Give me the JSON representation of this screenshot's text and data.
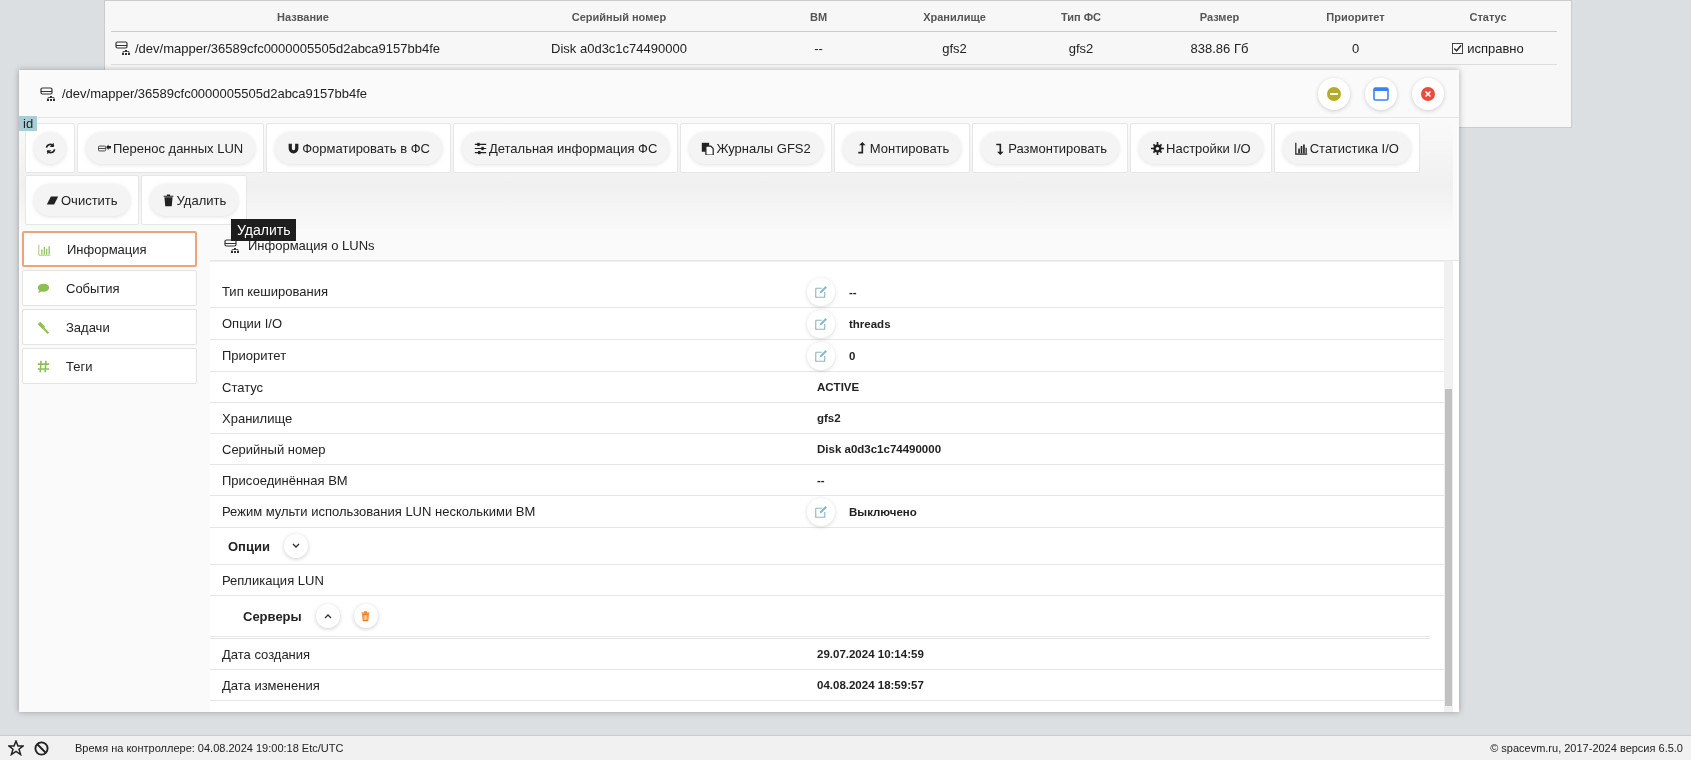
{
  "background_table": {
    "columns": [
      "Название",
      "Серийный номер",
      "ВМ",
      "Хранилище",
      "Тип ФС",
      "Размер",
      "Приоритет",
      "Статус"
    ],
    "rows": [
      {
        "cells": [
          "/dev/mapper/36589cfc0000005505d2abca9157bb4fe",
          "Disk a0d3c1c74490000",
          "--",
          "gfs2",
          "gfs2",
          "838.86 Гб",
          "0",
          "исправно"
        ]
      }
    ]
  },
  "window": {
    "title": "/dev/mapper/36589cfc0000005505d2abca9157bb4fe"
  },
  "badge": "id",
  "toolbar": {
    "rows": [
      [
        "",
        "Перенос данных LUN",
        "Форматировать в ФС",
        "Детальная информация ФС",
        "Журналы GFS2",
        "Монтировать",
        "Размонтировать",
        "Настройки I/O",
        "Статистика I/O"
      ],
      [
        "Очистить",
        "Удалить"
      ]
    ]
  },
  "tooltip": "Удалить",
  "sidebar": {
    "items": [
      {
        "label": "Информация",
        "selected": true
      },
      {
        "label": "События",
        "selected": false
      },
      {
        "label": "Задачи",
        "selected": false
      },
      {
        "label": "Теги",
        "selected": false
      }
    ]
  },
  "content": {
    "title": "Информация о LUNs",
    "rows": [
      {
        "kind": "field",
        "label": "Тип кеширования",
        "value": "--",
        "editable": true
      },
      {
        "kind": "field",
        "label": "Опции I/O",
        "value": "threads",
        "editable": true
      },
      {
        "kind": "field",
        "label": "Приоритет",
        "value": "0",
        "editable": true
      },
      {
        "kind": "field",
        "label": "Статус",
        "value": "ACTIVE",
        "editable": false
      },
      {
        "kind": "field",
        "label": "Хранилище",
        "value": "gfs2",
        "editable": false
      },
      {
        "kind": "field",
        "label": "Серийный номер",
        "value": "Disk a0d3c1c74490000",
        "editable": false
      },
      {
        "kind": "field",
        "label": "Присоединённая ВМ",
        "value": "--",
        "editable": false
      },
      {
        "kind": "field",
        "label": "Режим мульти использования LUN несколькими ВМ",
        "value": "Выключено",
        "editable": true
      },
      {
        "kind": "section",
        "label": "Опции",
        "expanded": false,
        "deletable": false
      },
      {
        "kind": "field",
        "label": "Репликация LUN",
        "editable": false
      },
      {
        "kind": "section",
        "label": "Серверы",
        "expanded": true,
        "deletable": true
      },
      {
        "kind": "field",
        "label": "Дата создания",
        "value": "29.07.2024 10:14:59",
        "editable": false
      },
      {
        "kind": "field",
        "label": "Дата изменения",
        "value": "04.08.2024 18:59:57",
        "editable": false
      }
    ]
  },
  "status_bar": {
    "clock": "Время на контроллере: 04.08.2024 19:00:18 Etc/UTC",
    "copyright": "© spacevm.ru, 2017-2024 версия 6.5.0"
  }
}
